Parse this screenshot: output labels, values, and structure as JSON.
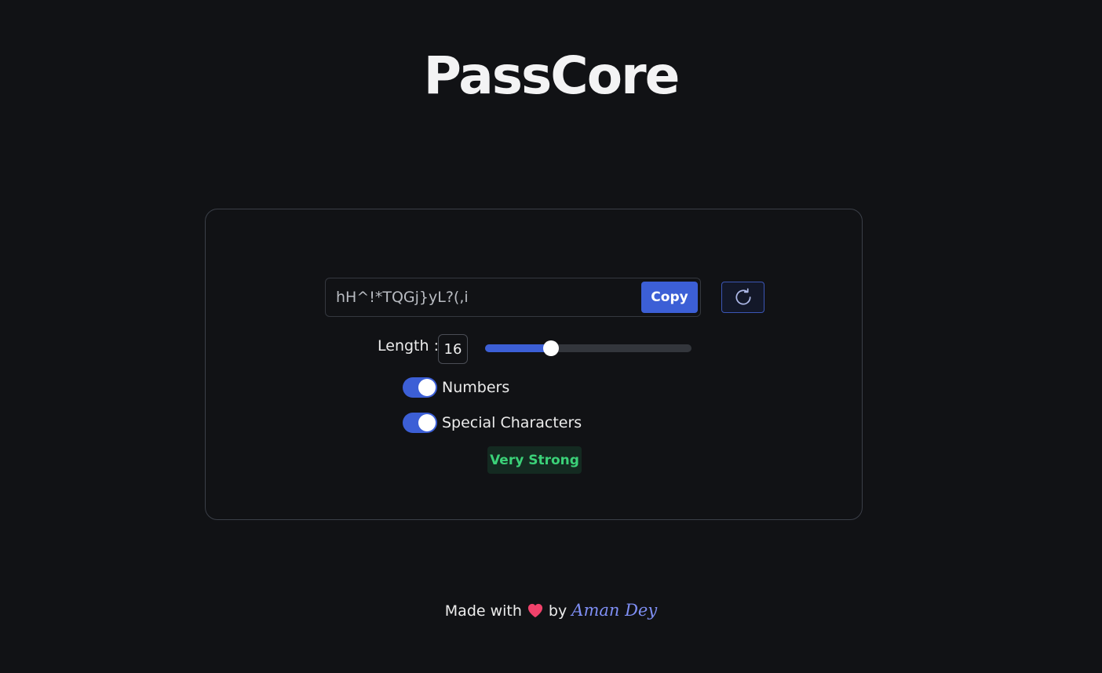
{
  "app": {
    "title": "PassCore"
  },
  "generator": {
    "password": "hH^!*TQGj}yL?(,i",
    "copy_label": "Copy",
    "refresh_icon": "refresh-icon",
    "length_label": "Length :",
    "length_value": "16",
    "length_slider_fraction": 0.32,
    "options": [
      {
        "label": "Numbers",
        "enabled": true
      },
      {
        "label": "Special Characters",
        "enabled": true
      }
    ],
    "strength_label": "Very Strong"
  },
  "footer": {
    "made_with": "Made with",
    "heart_icon": "heart-icon",
    "by": "by",
    "author": "Aman Dey"
  },
  "colors": {
    "background": "#111215",
    "accent": "#3c5fd6",
    "strength_text": "#3bd178",
    "strength_bg": "#142a21",
    "author_link": "#7f8ff5"
  }
}
